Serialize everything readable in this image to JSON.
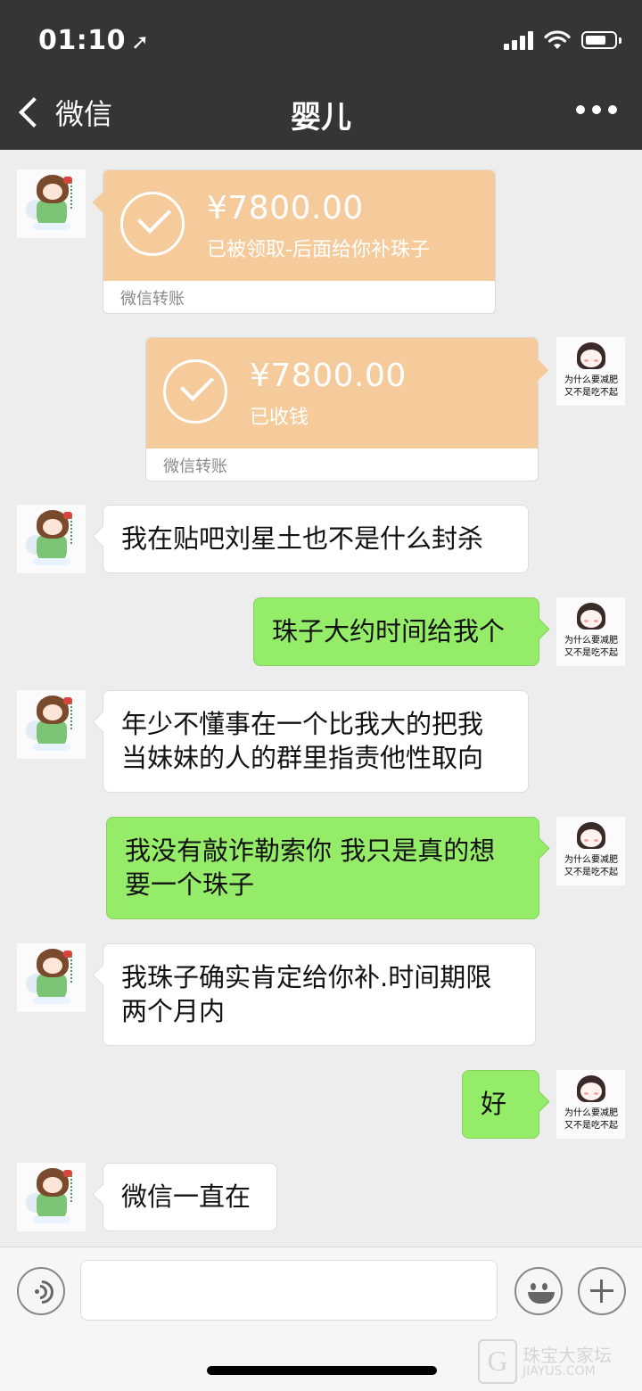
{
  "status_bar": {
    "time": "01:10",
    "location_glyph": "➚"
  },
  "nav": {
    "back_label": "微信",
    "title": "婴儿"
  },
  "avatars": {
    "contact_caption": "",
    "self_caption_line1": "为什么要减肥",
    "self_caption_line2": "又不是吃不起"
  },
  "messages": [
    {
      "side": "left",
      "type": "transfer",
      "amount": "¥7800.00",
      "note": "已被领取-后面给你补珠子",
      "footer": "微信转账"
    },
    {
      "side": "right",
      "type": "transfer",
      "amount": "¥7800.00",
      "note": "已收钱",
      "footer": "微信转账"
    },
    {
      "side": "left",
      "type": "text",
      "lines": [
        "我在贴吧刘星土也不是什么封杀"
      ]
    },
    {
      "side": "right",
      "type": "text",
      "lines": [
        "珠子大约时间给我个"
      ]
    },
    {
      "side": "left",
      "type": "text",
      "lines": [
        "年少不懂事在一个比我大的把我",
        "当妹妹的人的群里指责他性取向"
      ]
    },
    {
      "side": "right",
      "type": "text",
      "lines": [
        "我没有敲诈勒索你 我只是真的想",
        "要一个珠子"
      ]
    },
    {
      "side": "left",
      "type": "text",
      "lines": [
        "我珠子确实肯定给你补.时间期限",
        "两个月内"
      ]
    },
    {
      "side": "right",
      "type": "text",
      "lines": [
        "好"
      ]
    },
    {
      "side": "left",
      "type": "text",
      "lines": [
        "微信一直在"
      ]
    }
  ],
  "input_bar": {
    "input_value": ""
  },
  "watermark": {
    "logo_letter": "G",
    "text": "珠宝大家坛",
    "url": "JIAYUS.COM"
  },
  "colors": {
    "header_bg": "#353538",
    "chat_bg": "#ededed",
    "sent_bubble": "#95ec69",
    "received_bubble": "#ffffff",
    "transfer_card": "#f6cb9c"
  }
}
